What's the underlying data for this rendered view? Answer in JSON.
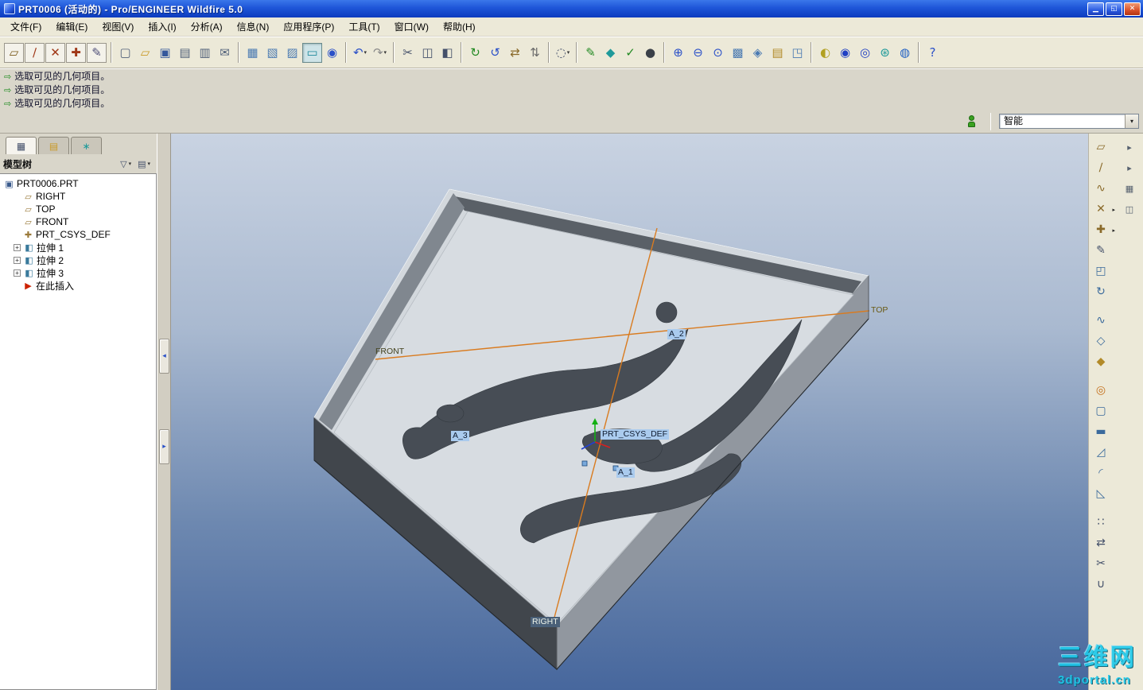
{
  "window": {
    "title": "PRT0006 (活动的) - Pro/ENGINEER Wildfire 5.0"
  },
  "glyphs": {
    "caret_down": "▾",
    "caret_right": "▸",
    "plus": "+",
    "minimize": "▁",
    "restore": "◱",
    "close": "✕",
    "msg_arrow": "⇨",
    "sash_left": "◂",
    "sash_right": "▸",
    "funnel": "▽",
    "list": "▤"
  },
  "menu": {
    "items": [
      "文件(F)",
      "编辑(E)",
      "视图(V)",
      "插入(I)",
      "分析(A)",
      "信息(N)",
      "应用程序(P)",
      "工具(T)",
      "窗口(W)",
      "帮助(H)"
    ]
  },
  "toolbar": {
    "icons": [
      {
        "name": "datum-plane-display",
        "glyph": "▱",
        "color": "#7a5a1a"
      },
      {
        "name": "datum-axis-display",
        "glyph": "∕",
        "color": "#a03818"
      },
      {
        "name": "datum-point-display",
        "glyph": "✕",
        "color": "#a03818"
      },
      {
        "name": "datum-csys-display",
        "glyph": "✚",
        "color": "#a03818"
      },
      {
        "name": "annotation-display",
        "glyph": "✎",
        "color": "#50507a"
      },
      {
        "name": "new-file",
        "glyph": "▢",
        "color": "#51617a"
      },
      {
        "name": "open-file",
        "glyph": "▱",
        "color": "#c99a28"
      },
      {
        "name": "save-file",
        "glyph": "▣",
        "color": "#35589c"
      },
      {
        "name": "print",
        "glyph": "▤",
        "color": "#51617a"
      },
      {
        "name": "print-preview",
        "glyph": "▥",
        "color": "#51617a"
      },
      {
        "name": "send-email",
        "glyph": "✉",
        "color": "#51617a"
      },
      {
        "name": "erase-display",
        "glyph": "▦",
        "color": "#4a7ab2"
      },
      {
        "name": "delete-old-versions",
        "glyph": "▧",
        "color": "#4a7ab2"
      },
      {
        "name": "backup-model",
        "glyph": "▨",
        "color": "#4a7ab2"
      },
      {
        "name": "display-style",
        "glyph": "▭",
        "color": "#1f8a9c"
      },
      {
        "name": "spin-center",
        "glyph": "◉",
        "color": "#2a50c8"
      },
      {
        "name": "undo",
        "glyph": "↶",
        "color": "#2a50c8"
      },
      {
        "name": "redo",
        "glyph": "↷",
        "color": "#8a8a8a"
      },
      {
        "name": "cut",
        "glyph": "✂",
        "color": "#44506a"
      },
      {
        "name": "copy",
        "glyph": "◫",
        "color": "#44506a"
      },
      {
        "name": "paste",
        "glyph": "◧",
        "color": "#44506a"
      },
      {
        "name": "regenerate",
        "glyph": "↻",
        "color": "#238a23"
      },
      {
        "name": "custom-regenerate",
        "glyph": "↺",
        "color": "#2a50c8"
      },
      {
        "name": "regeneration-manager",
        "glyph": "⇄",
        "color": "#8a6a2a"
      },
      {
        "name": "model-cleanup",
        "glyph": "⇅",
        "color": "#6a6a6a"
      },
      {
        "name": "search-tool",
        "glyph": "◌",
        "color": "#44506a"
      },
      {
        "name": "sketcher-diagnostics",
        "glyph": "✎",
        "color": "#238a23"
      },
      {
        "name": "edit-points",
        "glyph": "◆",
        "color": "#1f9a9a"
      },
      {
        "name": "verify",
        "glyph": "✓",
        "color": "#238a23"
      },
      {
        "name": "shaded-display",
        "glyph": "●",
        "color": "#3a4048"
      },
      {
        "name": "zoom-in",
        "glyph": "⊕",
        "color": "#2a50c8"
      },
      {
        "name": "zoom-out",
        "glyph": "⊖",
        "color": "#2a50c8"
      },
      {
        "name": "refit",
        "glyph": "⊙",
        "color": "#2a50c8"
      },
      {
        "name": "repaint",
        "glyph": "▩",
        "color": "#4a7ab2"
      },
      {
        "name": "reorient",
        "glyph": "◈",
        "color": "#4a7ab2"
      },
      {
        "name": "layers",
        "glyph": "▤",
        "color": "#b28a28"
      },
      {
        "name": "view-manager",
        "glyph": "◳",
        "color": "#4a7ab2"
      },
      {
        "name": "appearance-gallery",
        "glyph": "◐",
        "color": "#b2a020"
      },
      {
        "name": "render-window",
        "glyph": "◉",
        "color": "#2040c4"
      },
      {
        "name": "perspective-view",
        "glyph": "◎",
        "color": "#2040c4"
      },
      {
        "name": "environment-effects",
        "glyph": "⊛",
        "color": "#1f9a9a"
      },
      {
        "name": "web-browser",
        "glyph": "◍",
        "color": "#2060c4"
      },
      {
        "name": "context-help",
        "glyph": "?",
        "color": "#2a50c8"
      }
    ]
  },
  "messages": {
    "lines": [
      "选取可见的几何项目。",
      "选取可见的几何项目。",
      "选取可见的几何项目。"
    ]
  },
  "filter_bar": {
    "selected": "智能"
  },
  "model_tree": {
    "title": "模型树",
    "tabs": [
      {
        "name": "model-tree-tab",
        "glyph": "▦",
        "color": "#44506a"
      },
      {
        "name": "folder-browser-tab",
        "glyph": "▤",
        "color": "#c99a28"
      },
      {
        "name": "favorites-tab",
        "glyph": "∗",
        "color": "#1f9a9a"
      }
    ],
    "items": [
      {
        "label": "PRT0006.PRT",
        "glyph": "▣",
        "color": "#3a5a8c"
      },
      {
        "label": "RIGHT",
        "glyph": "▱",
        "color": "#9a7a3a"
      },
      {
        "label": "TOP",
        "glyph": "▱",
        "color": "#9a7a3a"
      },
      {
        "label": "FRONT",
        "glyph": "▱",
        "color": "#9a7a3a"
      },
      {
        "label": "PRT_CSYS_DEF",
        "glyph": "✚",
        "color": "#9a7a3a"
      },
      {
        "label": "拉伸 1",
        "glyph": "◧",
        "color": "#3a7a9c"
      },
      {
        "label": "拉伸 2",
        "glyph": "◧",
        "color": "#3a7a9c"
      },
      {
        "label": "拉伸 3",
        "glyph": "◧",
        "color": "#3a7a9c"
      },
      {
        "label": "在此插入",
        "glyph": "▶",
        "color": "#cc2200"
      }
    ]
  },
  "viewport": {
    "labels": {
      "top": "TOP",
      "front": "FRONT",
      "right": "RIGHT",
      "csys": "PRT_CSYS_DEF",
      "axis1": "A_1",
      "axis2": "A_2",
      "axis3": "A_3"
    }
  },
  "right_toolbar": {
    "icons": [
      {
        "name": "datum-plane-tool",
        "glyph": "▱",
        "color": "#8a6a2a"
      },
      {
        "name": "datum-axis-tool",
        "glyph": "∕",
        "color": "#8a6a2a"
      },
      {
        "name": "datum-curve-tool",
        "glyph": "∿",
        "color": "#8a6a2a"
      },
      {
        "name": "datum-point-tool",
        "glyph": "✕",
        "color": "#8a6a2a"
      },
      {
        "name": "datum-csys-tool",
        "glyph": "✚",
        "color": "#8a6a2a"
      },
      {
        "name": "sketch-tool",
        "glyph": "✎",
        "color": "#44506a"
      },
      {
        "name": "extrude-tool",
        "glyph": "◰",
        "color": "#3a6a9c"
      },
      {
        "name": "revolve-tool",
        "glyph": "↻",
        "color": "#3a6a9c"
      },
      {
        "name": "sweep-tool",
        "glyph": "∿",
        "color": "#3a6a9c"
      },
      {
        "name": "boundary-blend-tool",
        "glyph": "◇",
        "color": "#3a6a9c"
      },
      {
        "name": "style-tool",
        "glyph": "◆",
        "color": "#b28a28"
      },
      {
        "name": "hole-tool",
        "glyph": "◎",
        "color": "#c4701c"
      },
      {
        "name": "shell-tool",
        "glyph": "▢",
        "color": "#3a6a9c"
      },
      {
        "name": "rib-tool",
        "glyph": "▬",
        "color": "#3a6a9c"
      },
      {
        "name": "draft-tool",
        "glyph": "◿",
        "color": "#3a6a9c"
      },
      {
        "name": "round-tool",
        "glyph": "◜",
        "color": "#3a6a9c"
      },
      {
        "name": "chamfer-tool",
        "glyph": "◺",
        "color": "#3a6a9c"
      },
      {
        "name": "pattern-tool",
        "glyph": "∷",
        "color": "#44506a"
      },
      {
        "name": "mirror-tool",
        "glyph": "⇄",
        "color": "#44506a"
      },
      {
        "name": "trim-tool",
        "glyph": "✂",
        "color": "#44506a"
      },
      {
        "name": "merge-tool",
        "glyph": "∪",
        "color": "#44506a"
      }
    ],
    "aux": [
      {
        "name": "chevron-right",
        "glyph": "▸"
      },
      {
        "name": "chevron-right",
        "glyph": "▸"
      },
      {
        "name": "grid-toggle",
        "glyph": "▦"
      },
      {
        "name": "split-window",
        "glyph": "◫"
      }
    ]
  },
  "watermark": {
    "line1": "三维网",
    "line2": "3dportal.cn"
  },
  "colors": {
    "titlebar": "#1a4fd6",
    "datum_line": "#d97b1f",
    "viewport_top": "#c9d3e2",
    "viewport_bottom": "#47679d",
    "highlight_label": "#aacbee",
    "selected_label_bg": "#4a6078"
  }
}
